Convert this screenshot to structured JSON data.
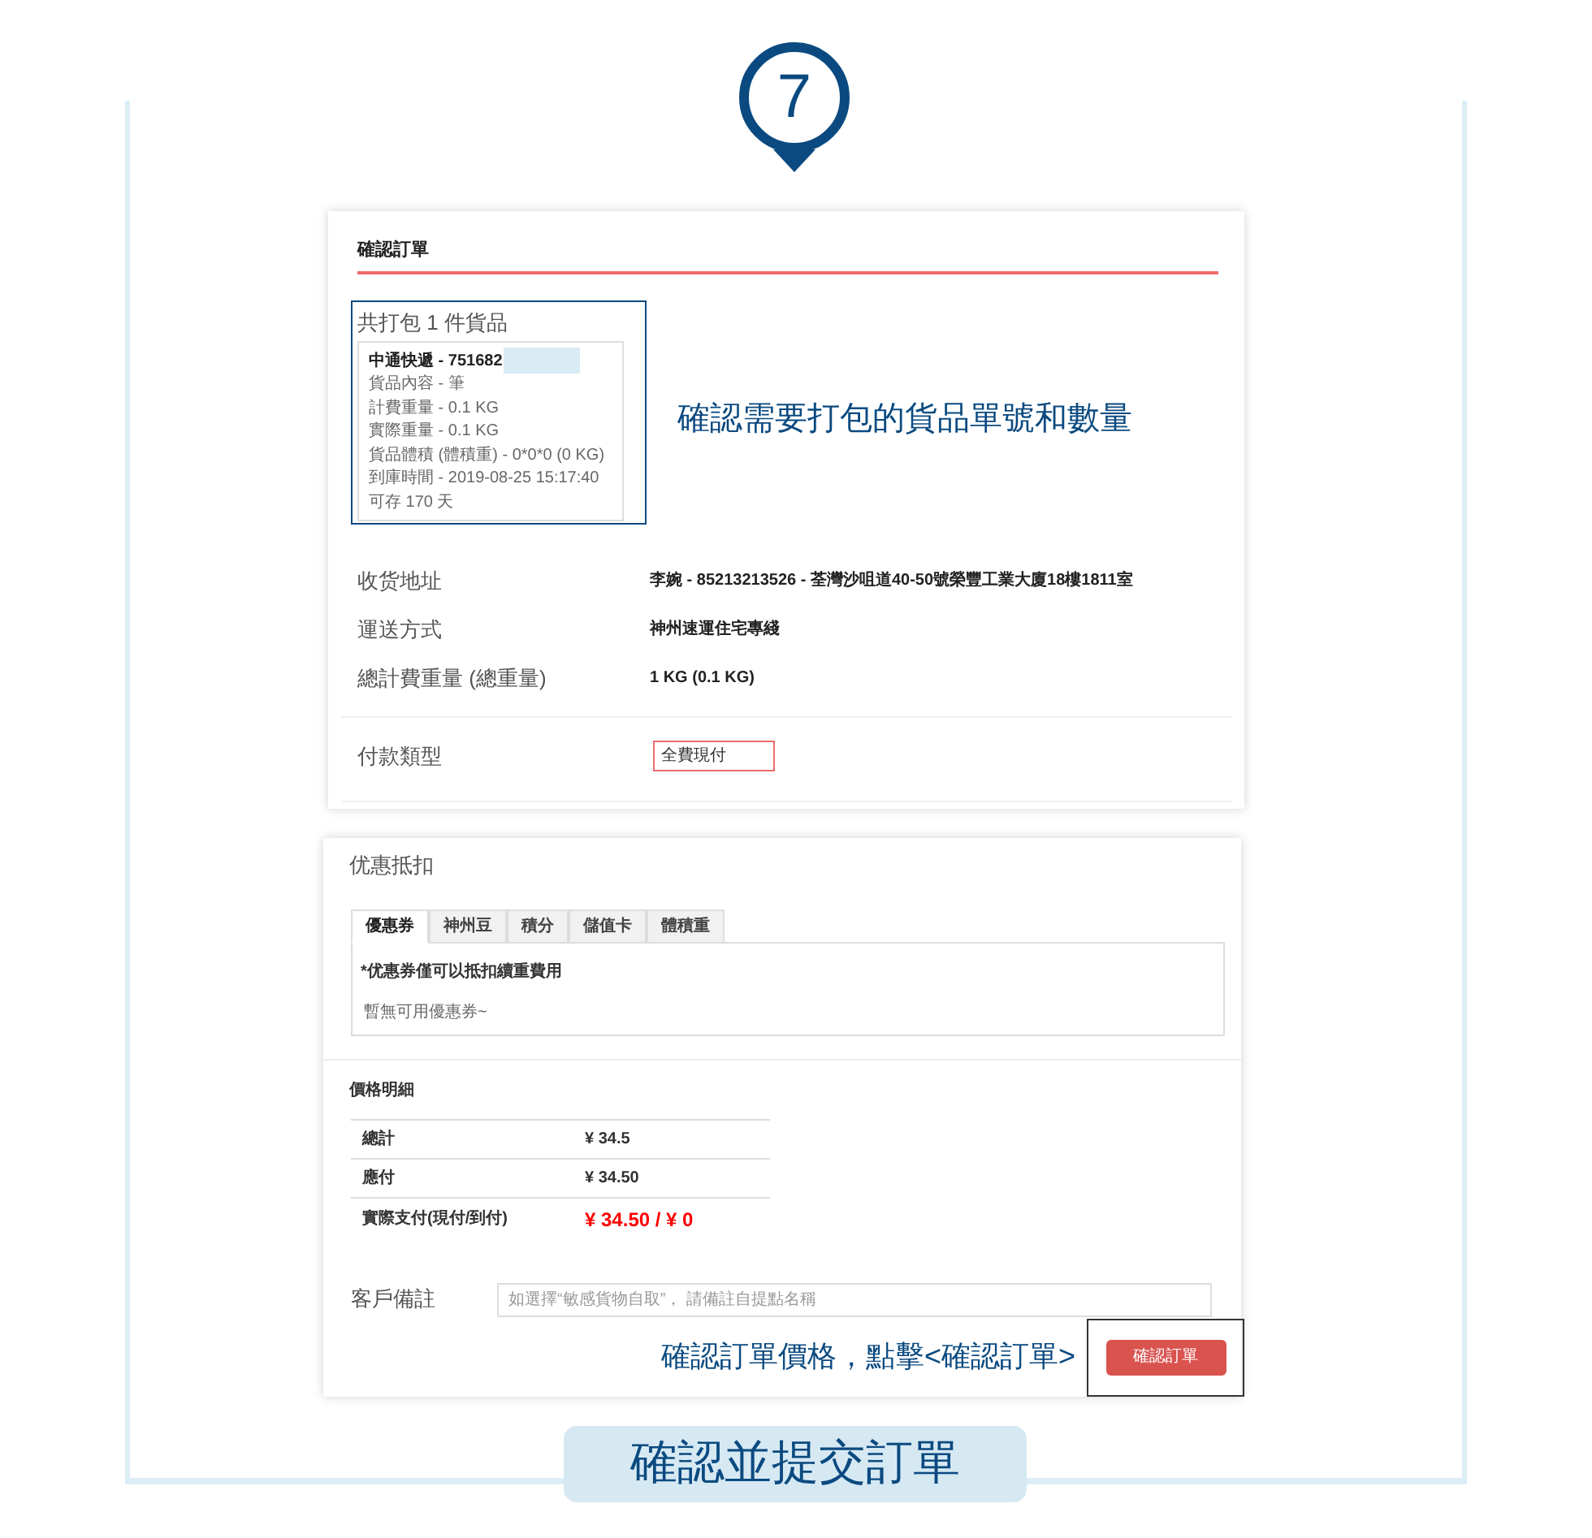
{
  "step": "7",
  "order": {
    "title": "確認訂單",
    "package_summary": "共打包 1 件貨品",
    "package": {
      "heading": "中通快遞 - 751682",
      "lines": [
        "貨品內容 - 筆",
        "計費重量 - 0.1 KG",
        "實際重量 - 0.1 KG",
        "貨品體積 (體積重) - 0*0*0 (0 KG)",
        "到庫時間 - 2019-08-25 15:17:40",
        "可存 170 天"
      ]
    },
    "annotation": "確認需要打包的貨品單號和數量",
    "details": [
      {
        "label": "收货地址",
        "value": "李婉 - 85213213526 - 荃灣沙咀道40-50號榮豐工業大廈18樓1811室"
      },
      {
        "label": "運送方式",
        "value": "神州速運住宅專綫"
      },
      {
        "label": "總計費重量 (總重量)",
        "value": "1 KG (0.1 KG)"
      }
    ],
    "payment": {
      "label": "付款類型",
      "value": "全費現付"
    }
  },
  "discount": {
    "title": "优惠抵扣",
    "tabs": [
      {
        "label": "優惠券",
        "selected": true
      },
      {
        "label": "神州豆",
        "selected": false
      },
      {
        "label": "積分",
        "selected": false
      },
      {
        "label": "儲值卡",
        "selected": false
      },
      {
        "label": "體積重",
        "selected": false
      }
    ],
    "note": "*优惠券僅可以抵扣續重費用",
    "empty": "暫無可用優惠券~"
  },
  "price": {
    "title": "價格明細",
    "rows": [
      {
        "label": "總計",
        "value": "¥ 34.5",
        "kind": "normal"
      },
      {
        "label": "應付",
        "value": "¥ 34.50",
        "kind": "normal"
      },
      {
        "label": "實際支付(現付/到付)",
        "value": "¥ 34.50 / ¥ 0",
        "kind": "highlight"
      }
    ]
  },
  "remark": {
    "label": "客戶備註",
    "placeholder": "如選擇“敏感貨物自取”， 請備註自提點名稱"
  },
  "annotation": "確認訂單價格，點擊<確認訂單>",
  "confirm_button": "確認訂單",
  "caption": "確認並提交訂單"
}
